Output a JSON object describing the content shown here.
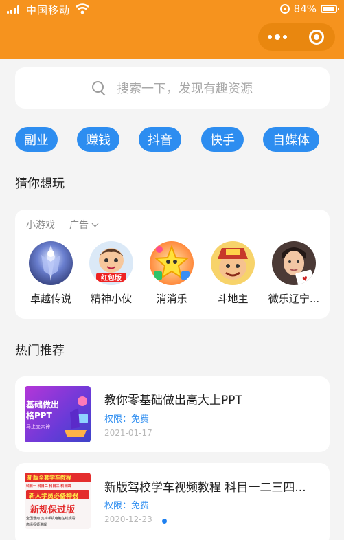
{
  "status_bar": {
    "carrier": "中国移动",
    "battery": "84%"
  },
  "search": {
    "placeholder": "搜索一下，发现有趣资源"
  },
  "tags": [
    "副业",
    "赚钱",
    "抖音",
    "快手",
    "自媒体"
  ],
  "guess": {
    "title": "猜你想玩",
    "source": "小游戏",
    "ad_label": "广告",
    "games": [
      {
        "name": "卓越传说",
        "icon": "warrior-icon"
      },
      {
        "name": "精神小伙",
        "icon": "cartoon-boy-icon",
        "badge": "红包版"
      },
      {
        "name": "消消乐",
        "icon": "star-gems-icon"
      },
      {
        "name": "斗地主",
        "icon": "landlord-icon"
      },
      {
        "name": "微乐辽宁...",
        "icon": "man-portrait-icon"
      }
    ]
  },
  "hot": {
    "title": "热门推荐",
    "items": [
      {
        "title": "教你零基础做出高大上PPT",
        "permission": "权限：免费",
        "date": "2021-01-17",
        "thumb": {
          "line1": "基础做出",
          "line2": "格PPT",
          "line3": "马上变大神"
        }
      },
      {
        "title": "新版驾校学车视频教程 科目一二三四...",
        "permission": "权限：免费",
        "date": "2020-12-23",
        "thumb": {
          "line1": "新版全套学车教程",
          "line2": "科目一 科目二 科目三 科目四",
          "line3": "新人学员必备神器",
          "line4": "新规保过版",
          "line5": "全国通用 支持手机电脑在线观看",
          "line6": "高清视频讲解"
        }
      }
    ]
  },
  "colors": {
    "header": "#f6931e",
    "accent": "#2d8df0"
  }
}
